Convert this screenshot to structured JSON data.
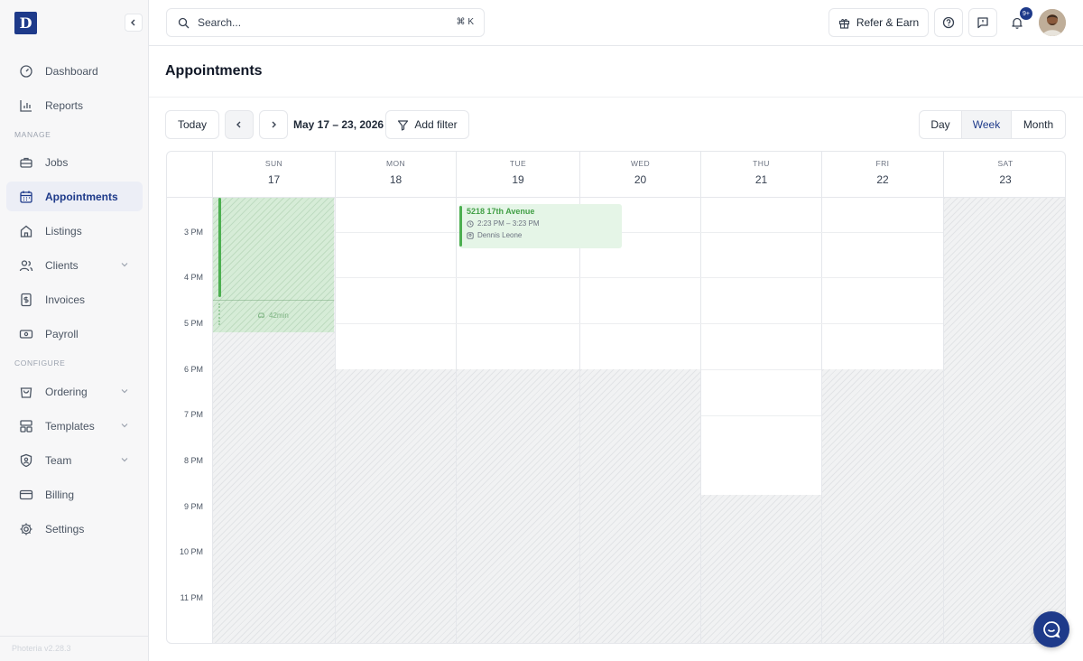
{
  "app": {
    "logo_letter": "D",
    "version": "Photeria v2.28.3"
  },
  "sidebar": {
    "items": [
      {
        "label": "Dashboard",
        "icon": "gauge-icon"
      },
      {
        "label": "Reports",
        "icon": "bar-chart-icon"
      },
      {
        "label": "Jobs",
        "icon": "briefcase-icon"
      },
      {
        "label": "Appointments",
        "icon": "calendar-icon",
        "active": true
      },
      {
        "label": "Listings",
        "icon": "home-icon"
      },
      {
        "label": "Clients",
        "icon": "users-icon",
        "expandable": true
      },
      {
        "label": "Invoices",
        "icon": "dollar-file-icon"
      },
      {
        "label": "Payroll",
        "icon": "banknote-icon"
      },
      {
        "label": "Ordering",
        "icon": "shopping-bag-icon",
        "expandable": true
      },
      {
        "label": "Templates",
        "icon": "layout-icon",
        "expandable": true
      },
      {
        "label": "Team",
        "icon": "shield-user-icon",
        "expandable": true
      },
      {
        "label": "Billing",
        "icon": "credit-card-icon"
      },
      {
        "label": "Settings",
        "icon": "gear-icon"
      }
    ],
    "sections": {
      "manage": "MANAGE",
      "configure": "CONFIGURE"
    }
  },
  "topbar": {
    "search_placeholder": "Search...",
    "search_shortcut": "⌘ K",
    "refer_label": "Refer & Earn",
    "notification_count": "9+"
  },
  "page": {
    "title": "Appointments"
  },
  "toolbar": {
    "today_label": "Today",
    "date_range": "May 17 – 23, 2026",
    "add_filter_label": "Add filter",
    "views": [
      "Day",
      "Week",
      "Month"
    ],
    "active_view": "Week"
  },
  "calendar": {
    "days": [
      {
        "name": "SUN",
        "num": "17"
      },
      {
        "name": "MON",
        "num": "18"
      },
      {
        "name": "TUE",
        "num": "19"
      },
      {
        "name": "WED",
        "num": "20"
      },
      {
        "name": "THU",
        "num": "21"
      },
      {
        "name": "FRI",
        "num": "22"
      },
      {
        "name": "SAT",
        "num": "23"
      }
    ],
    "times": [
      "3 PM",
      "4 PM",
      "5 PM",
      "6 PM",
      "7 PM",
      "8 PM",
      "9 PM",
      "10 PM",
      "11 PM"
    ],
    "events": [
      {
        "title": "5218 17th Avenue",
        "time": "2:23 PM – 3:23 PM",
        "person": "Dennis Leone",
        "day": "TUE"
      }
    ],
    "travel": {
      "label": "42min",
      "day": "SUN"
    }
  },
  "colors": {
    "brand": "#1e3a8a",
    "event_green": "#4caf50",
    "event_bg": "#e5f5e7"
  }
}
